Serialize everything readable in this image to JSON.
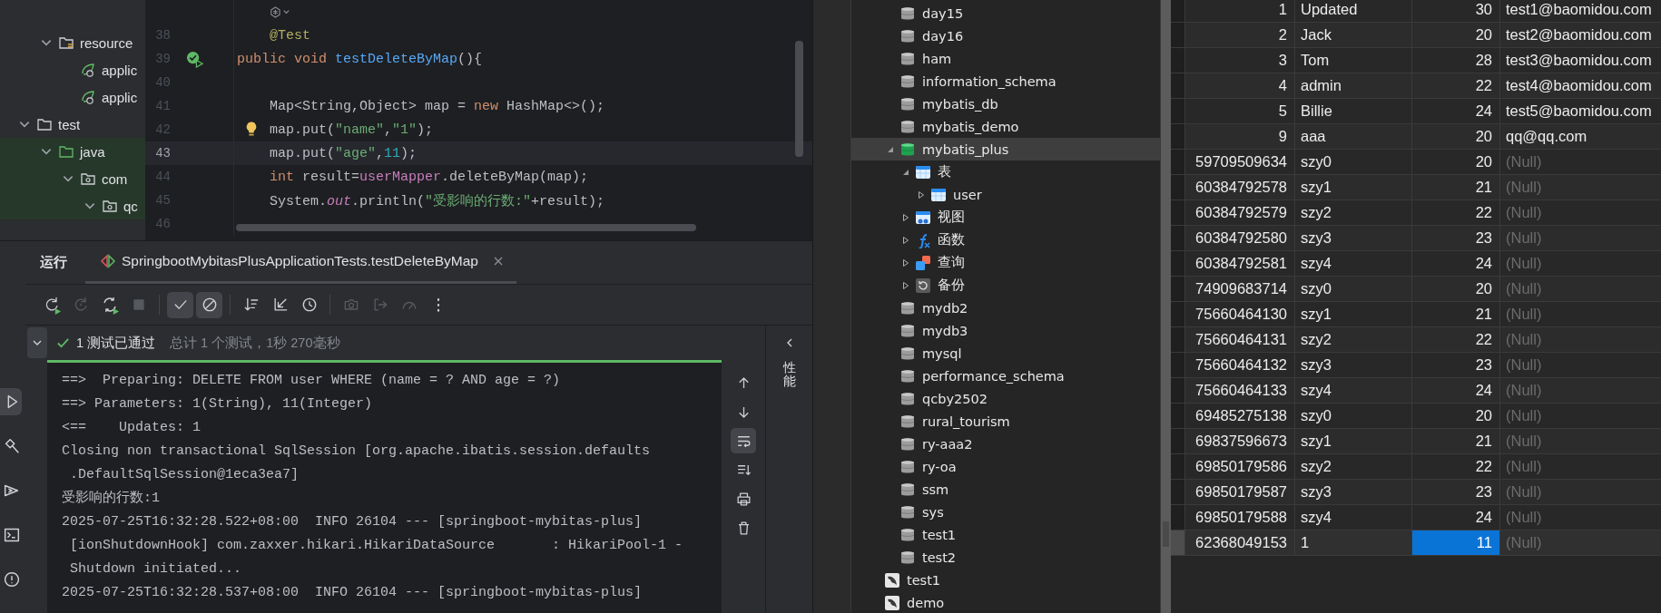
{
  "project_tree": {
    "nested_items": [
      {
        "label": "resource",
        "kind": "resource-folder",
        "expanded": true,
        "children": [
          {
            "label": "applic",
            "kind": "config"
          },
          {
            "label": "applic",
            "kind": "config"
          }
        ]
      }
    ],
    "items": [
      {
        "label": "test",
        "kind": "folder",
        "expanded": true,
        "children": [
          {
            "label": "java",
            "kind": "test-folder",
            "expanded": true,
            "children": [
              {
                "label": "com",
                "kind": "package",
                "expanded": true,
                "children": [
                  {
                    "label": "qc",
                    "kind": "package",
                    "expanded": true
                  }
                ]
              }
            ]
          }
        ]
      }
    ]
  },
  "editor": {
    "lines": [
      {
        "number": "38",
        "current": false,
        "indented": true,
        "tokens": [
          {
            "kind": "annotation",
            "text": "@Test"
          }
        ]
      },
      {
        "number": "39",
        "current": false,
        "indented": false,
        "run_gutter": true,
        "tokens": [
          {
            "kind": "keyword",
            "text": "public void "
          },
          {
            "kind": "method",
            "text": "testDeleteByMap"
          },
          {
            "kind": "plain",
            "text": "(){"
          }
        ]
      },
      {
        "number": "40",
        "current": false
      },
      {
        "number": "41",
        "current": false,
        "indented": true,
        "tokens": [
          {
            "kind": "plain",
            "text": "Map<String,Object> map = "
          },
          {
            "kind": "keyword",
            "text": "new"
          },
          {
            "kind": "plain",
            "text": " HashMap<>();"
          }
        ]
      },
      {
        "number": "42",
        "current": false,
        "indented": true,
        "intention_bulb": true,
        "tokens": [
          {
            "kind": "plain",
            "text": "map.put("
          },
          {
            "kind": "string",
            "text": "\"name\""
          },
          {
            "kind": "plain",
            "text": ","
          },
          {
            "kind": "string",
            "text": "\"1\""
          },
          {
            "kind": "plain",
            "text": ");"
          }
        ]
      },
      {
        "number": "43",
        "current": true,
        "indented": true,
        "tokens": [
          {
            "kind": "plain",
            "text": "map.put("
          },
          {
            "kind": "string",
            "text": "\"age\""
          },
          {
            "kind": "plain",
            "text": ","
          },
          {
            "kind": "number",
            "text": "11"
          },
          {
            "kind": "plain",
            "text": ");"
          }
        ]
      },
      {
        "number": "44",
        "current": false,
        "indented": true,
        "tokens": [
          {
            "kind": "keyword",
            "text": "int"
          },
          {
            "kind": "plain",
            "text": " result="
          },
          {
            "kind": "field",
            "text": "userMapper"
          },
          {
            "kind": "plain",
            "text": ".deleteByMap(map);"
          }
        ]
      },
      {
        "number": "45",
        "current": false,
        "indented": true,
        "tokens": [
          {
            "kind": "plain",
            "text": "System."
          },
          {
            "kind": "static",
            "text": "out"
          },
          {
            "kind": "plain",
            "text": ".println("
          },
          {
            "kind": "string",
            "text": "\"受影响的行数:\""
          },
          {
            "kind": "plain",
            "text": "+result);"
          }
        ]
      },
      {
        "number": "46",
        "current": false
      }
    ]
  },
  "left_strip": [
    {
      "kind": "run",
      "selected": true
    },
    {
      "kind": "build",
      "selected": false
    },
    {
      "kind": "services",
      "selected": false
    },
    {
      "kind": "terminal",
      "selected": false
    },
    {
      "kind": "problems",
      "selected": false
    }
  ],
  "run_panel": {
    "title": "运行",
    "tab": {
      "label": "SpringbootMybitasPlusApplicationTests.testDeleteByMap",
      "selected": true
    },
    "toolbar": [
      {
        "kind": "rerun",
        "disabled": false,
        "selected": false
      },
      {
        "kind": "rerun-failed",
        "disabled": true,
        "selected": false
      },
      {
        "kind": "toggle",
        "disabled": false,
        "selected": false
      },
      {
        "kind": "stop",
        "disabled": true,
        "selected": false
      },
      {
        "kind": "check",
        "disabled": false,
        "selected": true
      },
      {
        "kind": "ban",
        "disabled": false,
        "selected": true
      },
      {
        "kind": "sort",
        "disabled": false,
        "selected": false
      },
      {
        "kind": "collapse",
        "disabled": false,
        "selected": false
      },
      {
        "kind": "history",
        "disabled": false,
        "selected": false
      },
      {
        "kind": "camera",
        "disabled": true,
        "selected": false
      },
      {
        "kind": "export",
        "disabled": true,
        "selected": false
      },
      {
        "kind": "gauge",
        "disabled": true,
        "selected": false
      },
      {
        "kind": "more",
        "disabled": false,
        "selected": false
      }
    ],
    "result": {
      "passed": true,
      "summary": "1 测试已通过",
      "detail": "总计 1 个测试，1秒 270毫秒"
    },
    "progress": {
      "level": 1
    },
    "console": [
      "==>  Preparing: DELETE FROM user WHERE (name = ? AND age = ?)",
      "==> Parameters: 1(String), 11(Integer)",
      "<==    Updates: 1",
      "Closing non transactional SqlSession [org.apache.ibatis.session.defaults",
      " .DefaultSqlSession@1eca3ea7]",
      "受影响的行数:1",
      "2025-07-25T16:32:28.522+08:00  INFO 26104 --- [springboot-mybitas-plus]",
      " [ionShutdownHook] com.zaxxer.hikari.HikariDataSource       : HikariPool-1 -",
      " Shutdown initiated...",
      "2025-07-25T16:32:28.537+08:00  INFO 26104 --- [springboot-mybitas-plus]"
    ],
    "side_tools": [
      {
        "kind": "up",
        "selected": false
      },
      {
        "kind": "down",
        "selected": false
      },
      {
        "kind": "wrap",
        "selected": true
      },
      {
        "kind": "scroll-end",
        "selected": false
      },
      {
        "kind": "print",
        "selected": false
      },
      {
        "kind": "trash",
        "selected": false
      }
    ],
    "side_panel": {
      "label": "性能"
    }
  },
  "db_tree": {
    "databases": [
      {
        "label": "day15",
        "kind": "database",
        "open": false,
        "selected": false
      },
      {
        "label": "day16",
        "kind": "database",
        "open": false,
        "selected": false
      },
      {
        "label": "ham",
        "kind": "database",
        "open": false,
        "selected": false
      },
      {
        "label": "information_schema",
        "kind": "database",
        "open": false,
        "selected": false
      },
      {
        "label": "mybatis_db",
        "kind": "database",
        "open": false,
        "selected": false
      },
      {
        "label": "mybatis_demo",
        "kind": "database",
        "open": false,
        "selected": false
      },
      {
        "label": "mybatis_plus",
        "kind": "database",
        "open": true,
        "selected": true,
        "expanded": true,
        "children": [
          {
            "label": "表",
            "kind": "tables",
            "selected": false,
            "expanded": true,
            "children": [
              {
                "label": "user",
                "kind": "table",
                "selected": false,
                "expanded": false
              }
            ]
          },
          {
            "label": "视图",
            "kind": "views",
            "selected": false,
            "expanded": false
          },
          {
            "label": "函数",
            "kind": "functions",
            "selected": false,
            "expanded": false
          },
          {
            "label": "查询",
            "kind": "queries",
            "selected": false,
            "expanded": false
          },
          {
            "label": "备份",
            "kind": "backups",
            "selected": false,
            "expanded": false
          }
        ]
      },
      {
        "label": "mydb2",
        "kind": "database",
        "open": false,
        "selected": false
      },
      {
        "label": "mydb3",
        "kind": "database",
        "open": false,
        "selected": false
      },
      {
        "label": "mysql",
        "kind": "database",
        "open": false,
        "selected": false
      },
      {
        "label": "performance_schema",
        "kind": "database",
        "open": false,
        "selected": false
      },
      {
        "label": "qcby2502",
        "kind": "database",
        "open": false,
        "selected": false
      },
      {
        "label": "rural_tourism",
        "kind": "database",
        "open": false,
        "selected": false
      },
      {
        "label": "ry-aaa2",
        "kind": "database",
        "open": false,
        "selected": false
      },
      {
        "label": "ry-oa",
        "kind": "database",
        "open": false,
        "selected": false
      },
      {
        "label": "ssm",
        "kind": "database",
        "open": false,
        "selected": false
      },
      {
        "label": "sys",
        "kind": "database",
        "open": false,
        "selected": false
      },
      {
        "label": "test1",
        "kind": "database",
        "open": false,
        "selected": false
      },
      {
        "label": "test2",
        "kind": "database",
        "open": false,
        "selected": false
      }
    ],
    "connections": [
      {
        "label": "test1",
        "kind": "connection",
        "selected": false
      },
      {
        "label": "demo",
        "kind": "connection",
        "selected": false
      }
    ]
  },
  "table": {
    "rows": [
      {
        "id": "1",
        "name": "Updated",
        "age": "30",
        "email": "test1@baomidou.com",
        "email_null": false,
        "selected": false
      },
      {
        "id": "2",
        "name": "Jack",
        "age": "20",
        "email": "test2@baomidou.com",
        "email_null": false,
        "selected": false
      },
      {
        "id": "3",
        "name": "Tom",
        "age": "28",
        "email": "test3@baomidou.com",
        "email_null": false,
        "selected": false
      },
      {
        "id": "4",
        "name": "admin",
        "age": "22",
        "email": "test4@baomidou.com",
        "email_null": false,
        "selected": false
      },
      {
        "id": "5",
        "name": "Billie",
        "age": "24",
        "email": "test5@baomidou.com",
        "email_null": false,
        "selected": false
      },
      {
        "id": "9",
        "name": "aaa",
        "age": "20",
        "email": "qq@qq.com",
        "email_null": false,
        "selected": false
      },
      {
        "id": "59709509634",
        "name": "szy0",
        "age": "20",
        "email": "(Null)",
        "email_null": true,
        "selected": false
      },
      {
        "id": "60384792578",
        "name": "szy1",
        "age": "21",
        "email": "(Null)",
        "email_null": true,
        "selected": false
      },
      {
        "id": "60384792579",
        "name": "szy2",
        "age": "22",
        "email": "(Null)",
        "email_null": true,
        "selected": false
      },
      {
        "id": "60384792580",
        "name": "szy3",
        "age": "23",
        "email": "(Null)",
        "email_null": true,
        "selected": false
      },
      {
        "id": "60384792581",
        "name": "szy4",
        "age": "24",
        "email": "(Null)",
        "email_null": true,
        "selected": false
      },
      {
        "id": "74909683714",
        "name": "szy0",
        "age": "20",
        "email": "(Null)",
        "email_null": true,
        "selected": false
      },
      {
        "id": "75660464130",
        "name": "szy1",
        "age": "21",
        "email": "(Null)",
        "email_null": true,
        "selected": false
      },
      {
        "id": "75660464131",
        "name": "szy2",
        "age": "22",
        "email": "(Null)",
        "email_null": true,
        "selected": false
      },
      {
        "id": "75660464132",
        "name": "szy3",
        "age": "23",
        "email": "(Null)",
        "email_null": true,
        "selected": false
      },
      {
        "id": "75660464133",
        "name": "szy4",
        "age": "24",
        "email": "(Null)",
        "email_null": true,
        "selected": false
      },
      {
        "id": "69485275138",
        "name": "szy0",
        "age": "20",
        "email": "(Null)",
        "email_null": true,
        "selected": false
      },
      {
        "id": "69837596673",
        "name": "szy1",
        "age": "21",
        "email": "(Null)",
        "email_null": true,
        "selected": false
      },
      {
        "id": "69850179586",
        "name": "szy2",
        "age": "22",
        "email": "(Null)",
        "email_null": true,
        "selected": false
      },
      {
        "id": "69850179587",
        "name": "szy3",
        "age": "23",
        "email": "(Null)",
        "email_null": true,
        "selected": false
      },
      {
        "id": "69850179588",
        "name": "szy4",
        "age": "24",
        "email": "(Null)",
        "email_null": true,
        "selected": false
      },
      {
        "id": "62368049153",
        "name": "1",
        "age": "11",
        "email": "(Null)",
        "email_null": true,
        "selected": true
      }
    ]
  }
}
